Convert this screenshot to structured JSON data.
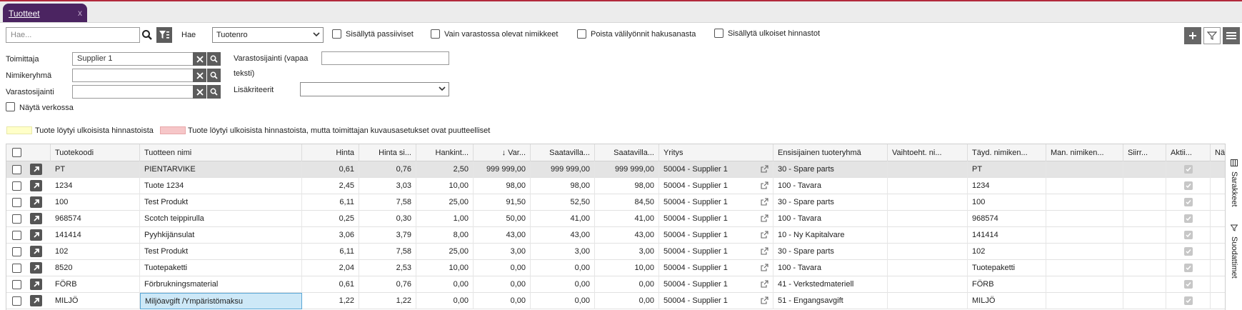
{
  "tab": {
    "label": "Tuotteet",
    "close": "x"
  },
  "search": {
    "placeholder": "Hae...",
    "hae_label": "Hae",
    "field_select": "Tuotenro",
    "options": {
      "include_passive": "Sisällytä passiiviset",
      "only_stock": "Vain varastossa olevat nimikkeet",
      "remove_spaces": "Poista välilyönnit hakusanasta",
      "include_external": "Sisällytä ulkoiset hinnastot"
    }
  },
  "filters": {
    "supplier_label": "Toimittaja",
    "supplier_value": "Supplier 1",
    "item_group_label": "Nimikeryhmä",
    "location_label": "Varastosijainti",
    "free_location_label_1": "Varastosijainti (vapaa",
    "free_location_label_2": "teksti)",
    "extra_criteria_label": "Lisäkriteerit",
    "show_online_label": "Näytä verkossa"
  },
  "legend": {
    "yellow_color": "#ffffc8",
    "yellow_text": "Tuote löytyi ulkoisista hinnastoista",
    "red_color": "#f6c6c8",
    "red_text": "Tuote löytyi ulkoisista hinnastoista, mutta toimittajan kuvausasetukset ovat puutteelliset"
  },
  "columns": {
    "code": "Tuotekoodi",
    "name": "Tuotteen nimi",
    "price": "Hinta",
    "price_vat": "Hinta si...",
    "purchase": "Hankint...",
    "stock": "↓ Var...",
    "avail1": "Saatavilla...",
    "avail2": "Saatavilla...",
    "company": "Yritys",
    "group": "Ensisijainen tuoteryhmä",
    "alt": "Vaihtoeht. ni...",
    "full_name": "Täyd. nimiken...",
    "man_name": "Man. nimiken...",
    "transfer": "Siirr...",
    "active": "Aktii...",
    "show": "Näy..."
  },
  "rows": [
    {
      "code": "PT",
      "name": "PIENTARVIKE",
      "price": "0,61",
      "price_vat": "0,76",
      "purchase": "2,50",
      "stock": "999 999,00",
      "avail1": "999 999,00",
      "avail2": "999 999,00",
      "company": "50004 - Supplier 1",
      "group": "30 - Spare parts",
      "full_name": "PT"
    },
    {
      "code": "1234",
      "name": "Tuote 1234",
      "price": "2,45",
      "price_vat": "3,03",
      "purchase": "10,00",
      "stock": "98,00",
      "avail1": "98,00",
      "avail2": "98,00",
      "company": "50004 - Supplier 1",
      "group": "100 - Tavara",
      "full_name": "1234"
    },
    {
      "code": "100",
      "name": "Test Produkt",
      "price": "6,11",
      "price_vat": "7,58",
      "purchase": "25,00",
      "stock": "91,50",
      "avail1": "52,50",
      "avail2": "84,50",
      "company": "50004 - Supplier 1",
      "group": "30 - Spare parts",
      "full_name": "100"
    },
    {
      "code": "968574",
      "name": "Scotch teippirulla",
      "price": "0,25",
      "price_vat": "0,30",
      "purchase": "1,00",
      "stock": "50,00",
      "avail1": "41,00",
      "avail2": "41,00",
      "company": "50004 - Supplier 1",
      "group": "100 - Tavara",
      "full_name": "968574"
    },
    {
      "code": "141414",
      "name": "Pyyhkijänsulat",
      "price": "3,06",
      "price_vat": "3,79",
      "purchase": "8,00",
      "stock": "43,00",
      "avail1": "43,00",
      "avail2": "43,00",
      "company": "50004 - Supplier 1",
      "group": "10 - Ny Kapitalvare",
      "full_name": "141414"
    },
    {
      "code": "102",
      "name": "Test Produkt",
      "price": "6,11",
      "price_vat": "7,58",
      "purchase": "25,00",
      "stock": "3,00",
      "avail1": "3,00",
      "avail2": "3,00",
      "company": "50004 - Supplier 1",
      "group": "30 - Spare parts",
      "full_name": "102"
    },
    {
      "code": "8520",
      "name": "Tuotepaketti",
      "price": "2,04",
      "price_vat": "2,53",
      "purchase": "10,00",
      "stock": "0,00",
      "avail1": "0,00",
      "avail2": "10,00",
      "company": "50004 - Supplier 1",
      "group": "100 - Tavara",
      "full_name": "Tuotepaketti"
    },
    {
      "code": "FÖRB",
      "name": "Förbrukningsmaterial",
      "price": "0,61",
      "price_vat": "0,76",
      "purchase": "0,00",
      "stock": "0,00",
      "avail1": "0,00",
      "avail2": "0,00",
      "company": "50004 - Supplier 1",
      "group": "41 - Verkstedmateriell",
      "full_name": "FÖRB"
    },
    {
      "code": "MILJÖ",
      "name": "Miljöavgift /Ympäristömaksu",
      "price": "1,22",
      "price_vat": "1,22",
      "purchase": "0,00",
      "stock": "0,00",
      "avail1": "0,00",
      "avail2": "0,00",
      "company": "50004 - Supplier 1",
      "group": "51 - Engangsavgift",
      "full_name": "MILJÖ"
    }
  ],
  "side_panel": {
    "columns": "Sarakkeet",
    "filters": "Suodattimet"
  }
}
